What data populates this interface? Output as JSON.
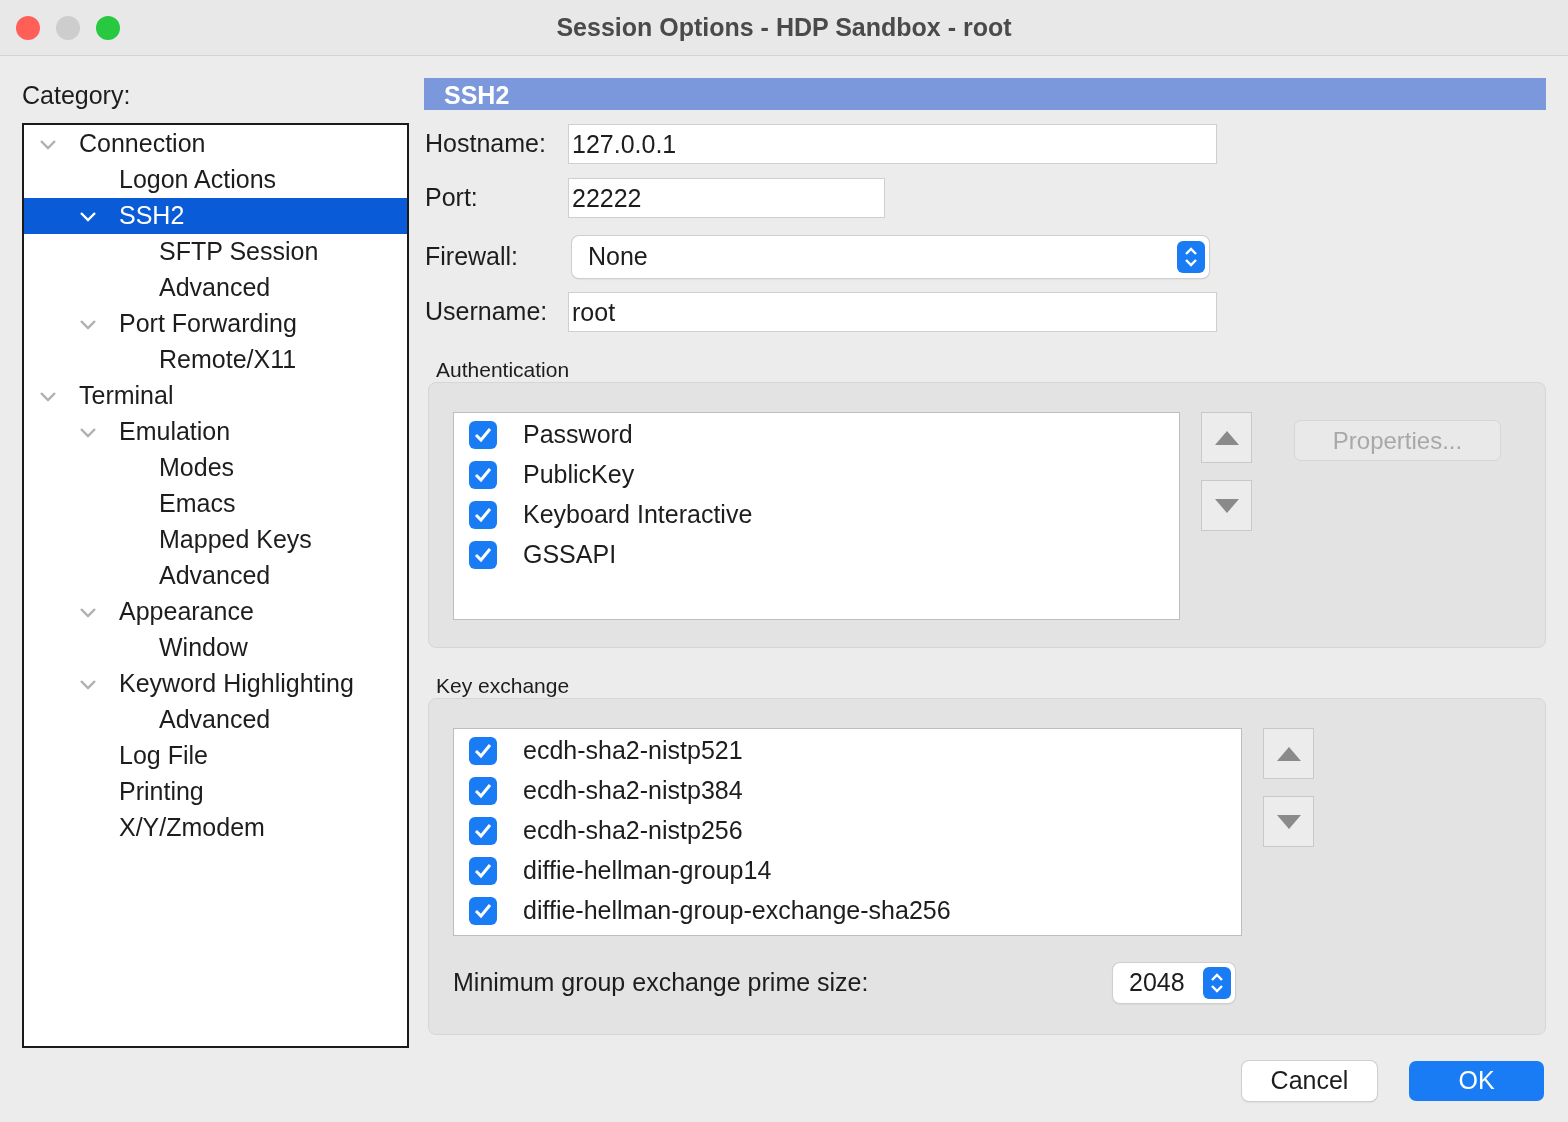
{
  "window": {
    "title": "Session Options - HDP Sandbox - root",
    "traffic_lights": [
      {
        "color": "#ff5f57"
      },
      {
        "color": "#cdcdcd"
      },
      {
        "color": "#28c840"
      }
    ]
  },
  "category": {
    "label": "Category:",
    "tree": [
      {
        "label": "Connection",
        "expanded": true,
        "selected": false,
        "children": [
          {
            "label": "Logon Actions",
            "selected": false
          },
          {
            "label": "SSH2",
            "expanded": true,
            "selected": true,
            "children": [
              {
                "label": "SFTP Session",
                "selected": false
              },
              {
                "label": "Advanced",
                "selected": false
              }
            ]
          },
          {
            "label": "Port Forwarding",
            "expanded": true,
            "selected": false,
            "children": [
              {
                "label": "Remote/X11",
                "selected": false
              }
            ]
          }
        ]
      },
      {
        "label": "Terminal",
        "expanded": true,
        "selected": false,
        "children": [
          {
            "label": "Emulation",
            "expanded": true,
            "selected": false,
            "children": [
              {
                "label": "Modes",
                "selected": false
              },
              {
                "label": "Emacs",
                "selected": false
              },
              {
                "label": "Mapped Keys",
                "selected": false
              },
              {
                "label": "Advanced",
                "selected": false
              }
            ]
          },
          {
            "label": "Appearance",
            "expanded": true,
            "selected": false,
            "children": [
              {
                "label": "Window",
                "selected": false
              }
            ]
          },
          {
            "label": "Keyword Highlighting",
            "expanded": true,
            "selected": false,
            "children": [
              {
                "label": "Advanced",
                "selected": false
              }
            ]
          },
          {
            "label": "Log File",
            "selected": false
          },
          {
            "label": "Printing",
            "selected": false
          },
          {
            "label": "X/Y/Zmodem",
            "selected": false
          }
        ]
      }
    ]
  },
  "panel": {
    "header": "SSH2",
    "fields": [
      {
        "kind": "text",
        "label": "Hostname:",
        "value": "127.0.0.1"
      },
      {
        "kind": "text",
        "label": "Port:",
        "value": "22222"
      },
      {
        "kind": "select",
        "label": "Firewall:",
        "value": "None"
      },
      {
        "kind": "text",
        "label": "Username:",
        "value": "root"
      }
    ]
  },
  "authentication": {
    "title": "Authentication",
    "methods": [
      {
        "label": "Password",
        "checked": true
      },
      {
        "label": "PublicKey",
        "checked": true
      },
      {
        "label": "Keyboard Interactive",
        "checked": true
      },
      {
        "label": "GSSAPI",
        "checked": true
      }
    ],
    "properties_button": {
      "label": "Properties...",
      "disabled": true
    }
  },
  "key_exchange": {
    "title": "Key exchange",
    "algorithms": [
      {
        "label": "ecdh-sha2-nistp521",
        "checked": true
      },
      {
        "label": "ecdh-sha2-nistp384",
        "checked": true
      },
      {
        "label": "ecdh-sha2-nistp256",
        "checked": true
      },
      {
        "label": "diffie-hellman-group14",
        "checked": true
      },
      {
        "label": "diffie-hellman-group-exchange-sha256",
        "checked": true
      }
    ],
    "min_prime": {
      "label": "Minimum group exchange prime size:",
      "value": "2048"
    }
  },
  "buttons": [
    {
      "label": "Cancel",
      "kind": "default"
    },
    {
      "label": "OK",
      "kind": "primary"
    }
  ]
}
